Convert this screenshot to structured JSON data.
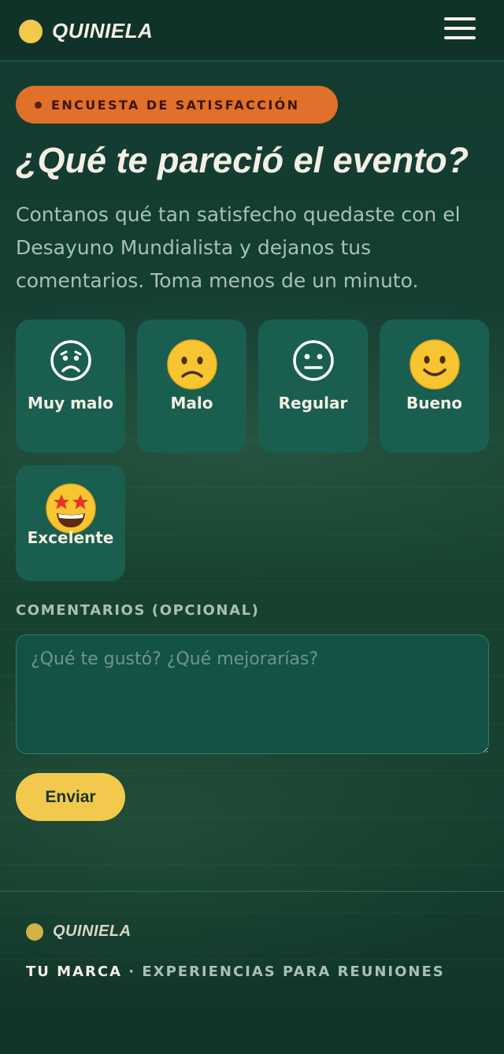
{
  "header": {
    "brand": "QUINIELA",
    "brand_color": "#f2c94c",
    "menu_icon": "hamburger-menu-icon"
  },
  "survey": {
    "badge": "ENCUESTA DE SATISFACCIÓN",
    "title": "¿Qué te pareció el evento?",
    "subtitle": "Contanos qué tan satisfecho quedaste con el Desayuno Mundialista y dejanos tus comentarios. Toma menos de un minuto.",
    "options": [
      {
        "label": "Muy malo",
        "icon": "very-sad-face-icon"
      },
      {
        "label": "Malo",
        "icon": "slightly-frowning-face-icon"
      },
      {
        "label": "Regular",
        "icon": "neutral-face-icon"
      },
      {
        "label": "Bueno",
        "icon": "slightly-smiling-face-icon"
      },
      {
        "label": "Excelente",
        "icon": "star-struck-face-icon"
      }
    ],
    "comments_label": "COMENTARIOS (OPCIONAL)",
    "comments_placeholder": "¿Qué te gustó? ¿Qué mejorarías?",
    "comments_value": "",
    "submit_label": "Enviar"
  },
  "footer": {
    "brand": "QUINIELA",
    "tagline_part1": "TU MARCA",
    "tagline_separator": " · ",
    "tagline_part2": "EXPERIENCIAS PARA REUNIONES"
  },
  "colors": {
    "background": "#153f33",
    "card": "#1a5e50",
    "badge": "#e0702a",
    "button": "#f2c94c",
    "text": "#f4efe4",
    "muted_text": "#a9c0b6"
  }
}
